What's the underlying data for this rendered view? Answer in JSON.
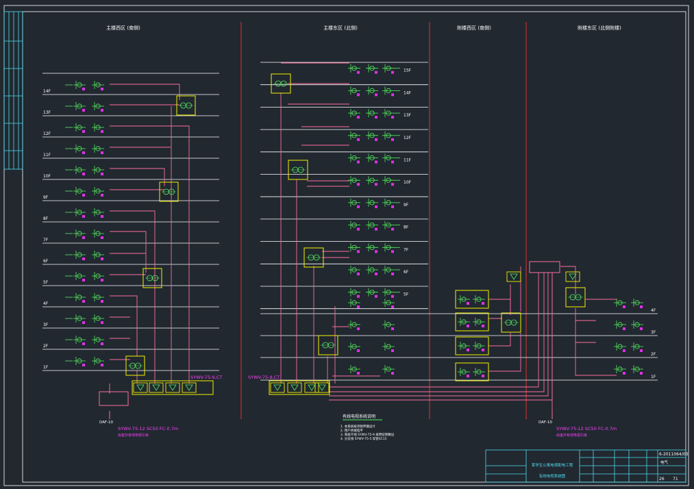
{
  "sections": [
    {
      "title": "主楼西区 (南侧)"
    },
    {
      "title": "主楼东区 (北侧)"
    },
    {
      "title": "附楼西区 (南侧)"
    },
    {
      "title": "附楼东区 (北侧附楼)"
    }
  ],
  "floors_left": [
    "14F",
    "13F",
    "12F",
    "11F",
    "10F",
    "9F",
    "8F",
    "7F",
    "6F",
    "5F",
    "4F",
    "3F",
    "2F",
    "1F"
  ],
  "floors_middle": [
    "15F",
    "14F",
    "13F",
    "12F",
    "11F",
    "10F",
    "9F",
    "8F",
    "7F",
    "6F",
    "5F"
  ],
  "floors_right": [
    "4F",
    "3F",
    "2F",
    "1F"
  ],
  "cables": {
    "left_trunk": "SYWV-75-9,CT",
    "middle_trunk": "SYWV-75-9,CT",
    "left_feed": "SYWV-75-12 SC50 FC-0.7m",
    "right_feed": "SYWV-75-12 SC50 FC-0.7m",
    "left_feed_note": "由室外有线电视引来",
    "right_feed_note": "由室外有线电视引来",
    "left_entry": "DAF-10",
    "right_entry": "DAF-10"
  },
  "notes": {
    "title": "有线电视系统说明",
    "lines": [
      "1. 本系统按邻频传输设计",
      "2. 用户终端电平",
      "3. 系统干线  SYWV-75-9 采用穿管敷设",
      "4. 分支线  SYWV-75-5 穿管SC15"
    ]
  },
  "title_block": {
    "project": "某学生公寓电视配电工程",
    "drawing": "有线电视系统图",
    "drawing_no": "6-2011064/03",
    "discipline": "电气",
    "sheet": "26",
    "sheets_total": "71"
  },
  "colors": {
    "background": "#212830",
    "frame": "#d8d8d8",
    "floor_line": "#ffffff",
    "divider": "#e8312f",
    "feeder": "#ff6e9e",
    "device": "#58f060",
    "box": "#f4f400",
    "outlet_fill": "#e030e8",
    "label": "#ffffff",
    "cable_text": "#ff40ff",
    "titleblock": "#4fdcf0"
  }
}
